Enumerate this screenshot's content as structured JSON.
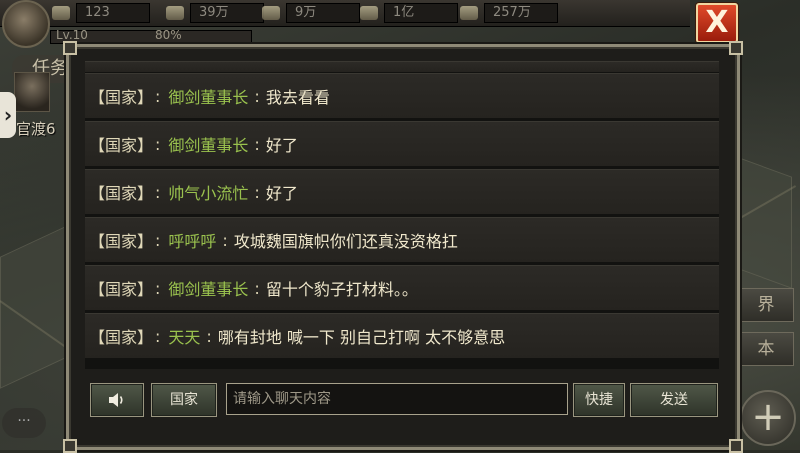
{
  "resources": [
    {
      "icon": "silver-icon",
      "value": "123"
    },
    {
      "icon": "tea-icon",
      "value": "39万"
    },
    {
      "icon": "wood-icon",
      "value": "9万"
    },
    {
      "icon": "stone-icon",
      "value": "1亿"
    },
    {
      "icon": "troops-icon",
      "value": "257万"
    }
  ],
  "player": {
    "level": "Lv.10",
    "progress_text": "80%",
    "task_label": "任务",
    "hero_name": "官渡6"
  },
  "right_buttons": {
    "world": "界",
    "base": "本"
  },
  "chat_bubble": "···",
  "close_label": "X",
  "messages": [
    {
      "channel": "【国家】",
      "sep": ":",
      "name": "御剑董事长",
      "text": "我去看看"
    },
    {
      "channel": "【国家】",
      "sep": ":",
      "name": "御剑董事长",
      "text": "好了"
    },
    {
      "channel": "【国家】",
      "sep": ":",
      "name": "帅气小流忙",
      "text": "好了"
    },
    {
      "channel": "【国家】",
      "sep": ":",
      "name": "呼呼呼",
      "text": "攻城魏国旗帜你们还真没资格扛"
    },
    {
      "channel": "【国家】",
      "sep": ":",
      "name": "御剑董事长",
      "text": "留十个豹子打材料。。"
    },
    {
      "channel": "【国家】",
      "sep": ":",
      "name": "天天",
      "text": "哪有封地 喊一下 别自己打啊 太不够意思"
    }
  ],
  "controls": {
    "sound_icon": "speaker-icon",
    "channel": "国家",
    "input_placeholder": "请输入聊天内容",
    "quick": "快捷",
    "send": "发送"
  },
  "colors": {
    "name": "#9ac24e",
    "channel": "#e0d8b8",
    "close": "#c8321a"
  }
}
